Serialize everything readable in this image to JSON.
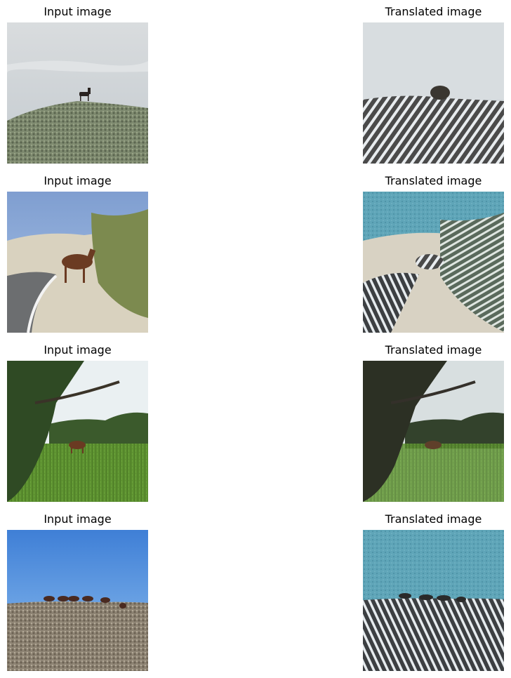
{
  "rows": [
    {
      "input_title": "Input image",
      "output_title": "Translated image"
    },
    {
      "input_title": "Input image",
      "output_title": "Translated image"
    },
    {
      "input_title": "Input image",
      "output_title": "Translated image"
    },
    {
      "input_title": "Input image",
      "output_title": "Translated image"
    }
  ]
}
